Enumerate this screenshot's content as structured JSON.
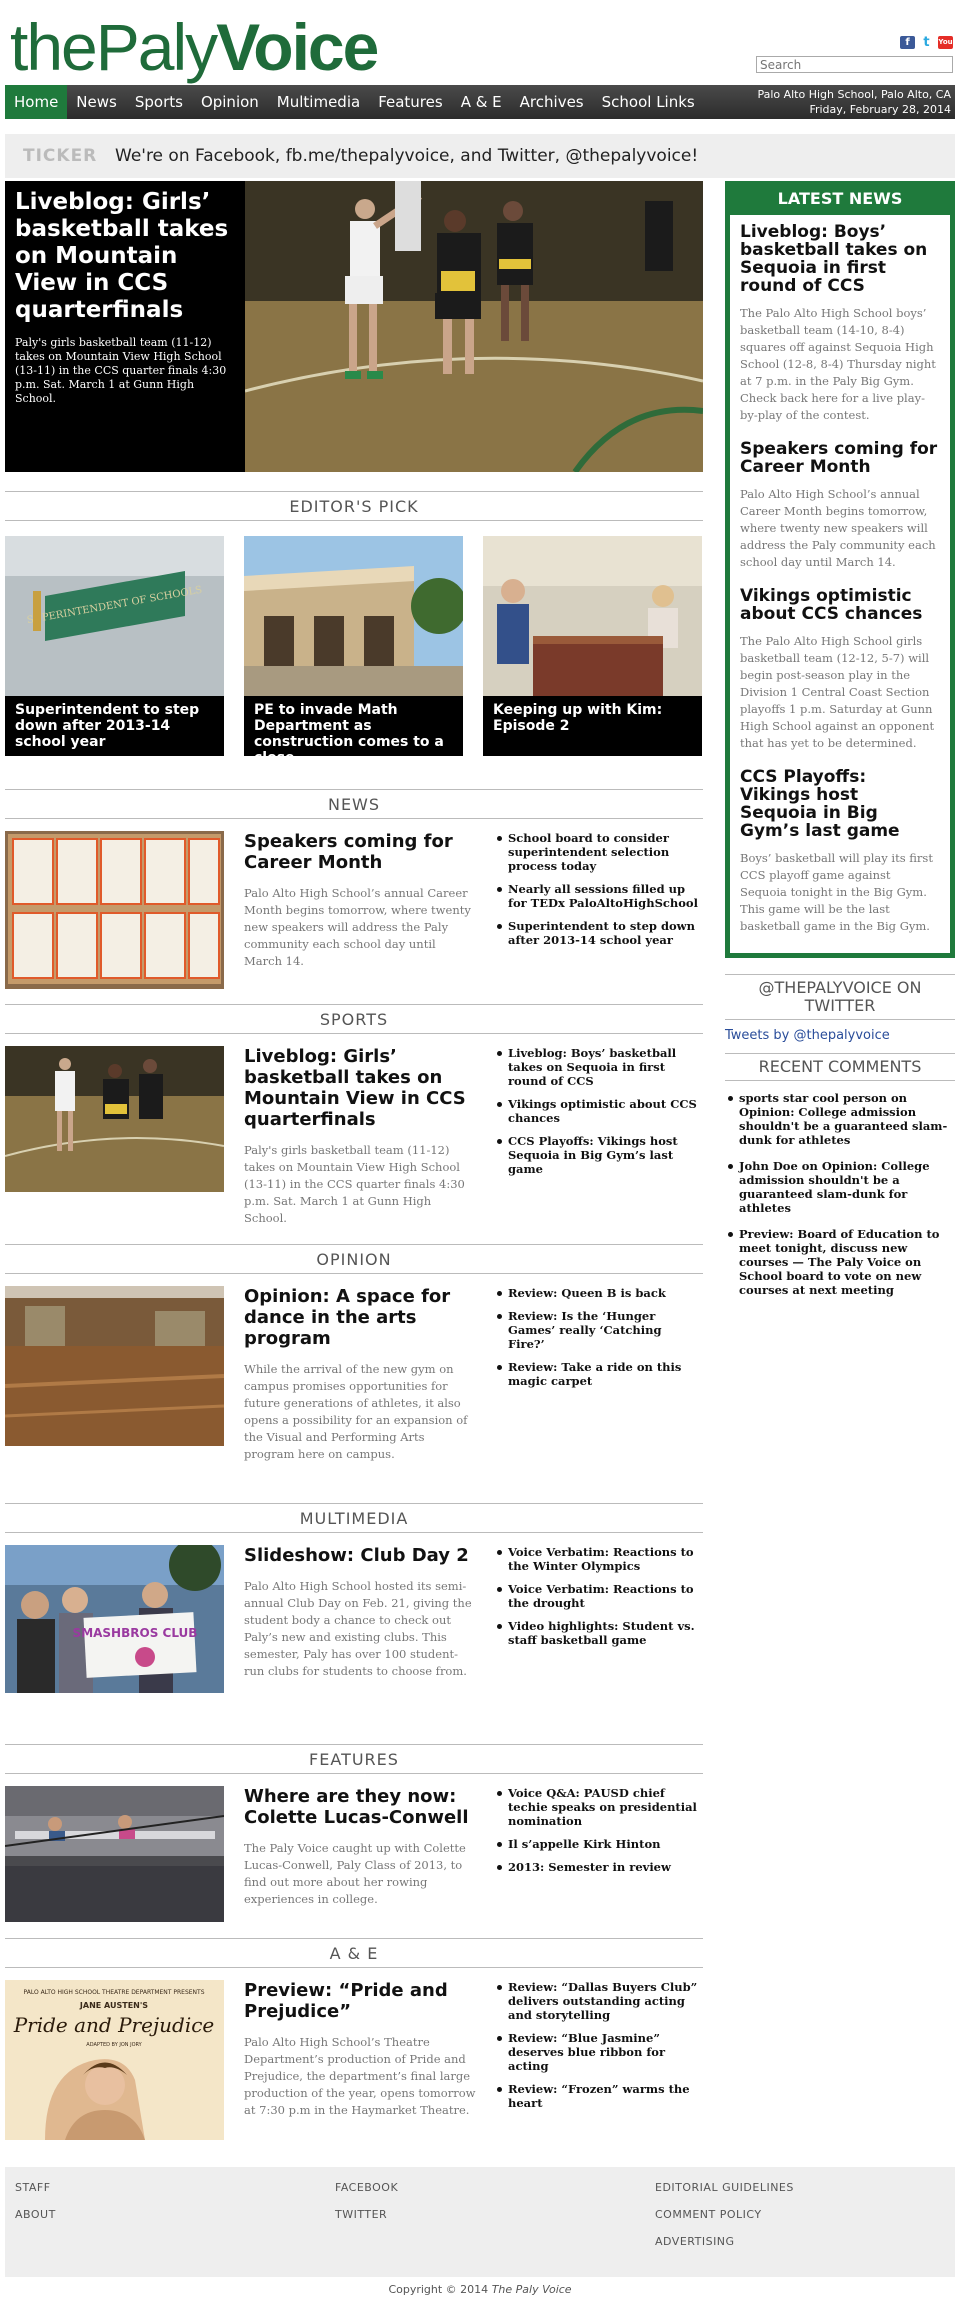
{
  "brand": {
    "logo_the": "the",
    "logo_paly": "Paly",
    "logo_voice": "Voice",
    "green": "#1f6b3a"
  },
  "social": {
    "facebook": "f",
    "twitter": "t",
    "youtube": "You"
  },
  "search": {
    "placeholder": "Search"
  },
  "nav": {
    "items": [
      "Home",
      "News",
      "Sports",
      "Opinion",
      "Multimedia",
      "Features",
      "A & E",
      "Archives",
      "School Links"
    ],
    "location": "Palo Alto High School, Palo Alto, CA",
    "date": "Friday, February 28, 2014"
  },
  "ticker": {
    "label": "TICKER",
    "message": "We're on Facebook, fb.me/thepalyvoice, and Twitter, @thepalyvoice!"
  },
  "hero": {
    "title": "Liveblog: Girls’ basketball takes on Mountain View in CCS quarterfinals",
    "summary": "Paly's girls basketball team (11-12) takes on Mountain View High School (13-11) in the CCS quarter finals 4:30 p.m. Sat. March 1 at Gunn High School."
  },
  "editors_pick": {
    "heading": "EDITOR'S PICK",
    "sign_text": "SUPERINTENDENT OF SCHOOLS",
    "items": [
      "Superintendent to step down after 2013-14 school year",
      "PE to invade Math Department as construction comes to a close",
      "Keeping up with Kim: Episode 2"
    ]
  },
  "sections": {
    "news": {
      "heading": "NEWS",
      "title": "Speakers coming for Career Month",
      "summary": "Palo Alto High School’s annual Career Month begins tomorrow, where twenty new speakers will address the Paly community each school day until March 14.",
      "links": [
        "School board to consider superintendent selection process today",
        "Nearly all sessions filled up for TEDx PaloAltoHighSchool",
        "Superintendent to step down after 2013-14 school year"
      ]
    },
    "sports": {
      "heading": "SPORTS",
      "title": "Liveblog: Girls’ basketball takes on Mountain View in CCS quarterfinals",
      "summary": "Paly's girls basketball team (11-12) takes on Mountain View High School (13-11) in the CCS quarter finals 4:30 p.m. Sat. March 1 at Gunn High School.",
      "links": [
        "Liveblog: Boys’ basketball takes on Sequoia in first round of CCS",
        "Vikings optimistic about CCS chances",
        "CCS Playoffs: Vikings host Sequoia in Big Gym’s last game"
      ]
    },
    "opinion": {
      "heading": "OPINION",
      "title": "Opinion: A space for dance in the arts program",
      "summary": "While the arrival of the new gym on campus promises opportunities for future generations of athletes, it also opens a possibility for an expansion of the Visual and Performing Arts program here on campus.",
      "links": [
        "Review: Queen B is back",
        "Review: Is the ‘Hunger Games’ really ‘Catching Fire?’",
        "Review: Take a ride on this magic carpet"
      ]
    },
    "multimedia": {
      "heading": "MULTIMEDIA",
      "title": "Slideshow: Club Day 2",
      "summary": "Palo Alto High School hosted its semi-annual Club Day on Feb. 21, giving the student body a chance to check out Paly’s new and existing clubs. This semester, Paly has over 100 student-run clubs for students to choose from.",
      "sign_text": "SMASHBROS CLUB",
      "links": [
        "Voice Verbatim: Reactions to the Winter Olympics",
        "Voice Verbatim: Reactions to the drought",
        "Video highlights: Student vs. staff basketball game"
      ]
    },
    "features": {
      "heading": "FEATURES",
      "title": "Where are they now: Colette Lucas-Conwell",
      "summary": "The Paly Voice caught up with Colette Lucas-Conwell, Paly Class of 2013, to find out more about her rowing experiences in college.",
      "links": [
        "Voice Q&A: PAUSD chief techie speaks on presidential nomination",
        "Il s’appelle Kirk Hinton",
        "2013: Semester in review"
      ]
    },
    "ae": {
      "heading": "A & E",
      "title": "Preview: “Pride and Prejudice”",
      "summary": "Palo Alto High School’s Theatre Department’s production of Pride and Prejudice, the department’s final large production of the year, opens tomorrow at 7:30 p.m in the Haymarket Theatre.",
      "poster_top": "PALO ALTO HIGH SCHOOL THEATRE DEPARTMENT PRESENTS",
      "poster_author": "JANE AUSTEN'S",
      "poster_title": "Pride and Prejudice",
      "poster_credit": "ADAPTED BY JON JORY",
      "links": [
        "Review: “Dallas Buyers Club” delivers outstanding acting and storytelling",
        "Review: “Blue Jasmine” deserves blue ribbon for acting",
        "Review: “Frozen” warms the heart"
      ]
    }
  },
  "sidebar": {
    "latest_heading": "LATEST NEWS",
    "latest": [
      {
        "title": "Liveblog: Boys’ basketball takes on Sequoia in first round of CCS",
        "summary": "The Palo Alto High School boys’ basketball team (14-10, 8-4) squares off against Sequoia High School (12-8, 8-4) Thursday night at 7 p.m. in the Paly Big Gym. Check back here for a live play-by-play of the contest."
      },
      {
        "title": "Speakers coming for Career Month",
        "summary": "Palo Alto High School’s annual Career Month begins tomorrow, where twenty new speakers will address the Paly community each school day until March 14."
      },
      {
        "title": "Vikings optimistic about CCS chances",
        "summary": "The Palo Alto High School girls basketball team (12-12, 5-7) will begin post-season play in the Division 1 Central Coast Section playoffs 1 p.m. Saturday at Gunn High School against an opponent that has yet to be determined."
      },
      {
        "title": "CCS Playoffs: Vikings host Sequoia in Big Gym’s last game",
        "summary": "Boys’ basketball will play its first CCS playoff game against Sequoia tonight in the Big Gym. This game will be the last basketball game in the Big Gym."
      }
    ],
    "twitter_heading": "@THEPALYVOICE ON TWITTER",
    "twitter_link": "Tweets by @thepalyvoice",
    "comments_heading": "RECENT COMMENTS",
    "comments": [
      "sports star cool person on Opinion: College admission shouldn't be a guaranteed slam-dunk for athletes",
      "John Doe on Opinion: College admission shouldn't be a guaranteed slam-dunk for athletes",
      "Preview: Board of Education to meet tonight, discuss new courses — The Paly Voice on School board to vote on new courses at next meeting"
    ]
  },
  "footer": {
    "col1": [
      "STAFF",
      "ABOUT"
    ],
    "col2": [
      "FACEBOOK",
      "TWITTER"
    ],
    "col3": [
      "EDITORIAL GUIDELINES",
      "COMMENT POLICY",
      "ADVERTISING"
    ],
    "copyright_prefix": "Copyright © 2014",
    "copyright_name": "The Paly Voice"
  }
}
